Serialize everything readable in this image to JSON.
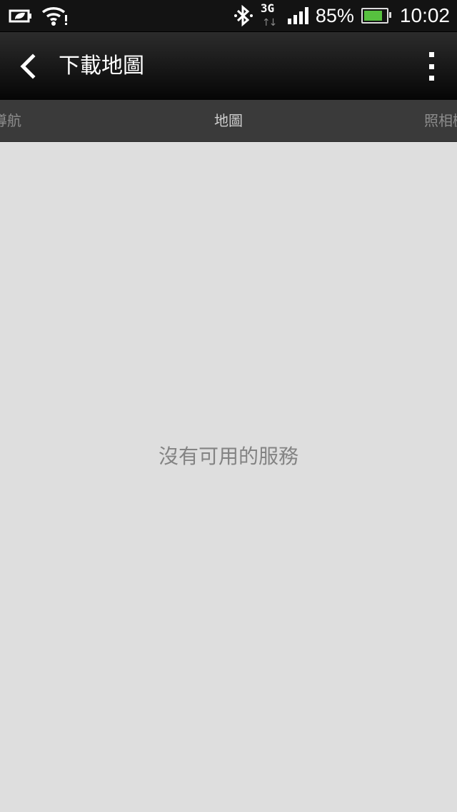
{
  "status_bar": {
    "battery_percent": "85%",
    "time": "10:02",
    "network_type": "3G",
    "battery_level": 0.85,
    "battery_color": "#57c13f",
    "icons": [
      "leaf-battery-icon",
      "wifi-icon",
      "bluetooth-icon",
      "3g-data-icon",
      "signal-icon",
      "battery-icon"
    ]
  },
  "action_bar": {
    "title": "下載地圖",
    "back_icon": "chevron-left-icon",
    "menu_icon": "overflow-menu-icon"
  },
  "tabs": [
    {
      "label": "導航",
      "state": "partial"
    },
    {
      "label": "地圖",
      "state": "selected"
    },
    {
      "label": "照相機",
      "state": "partial"
    }
  ],
  "content": {
    "empty_message": "沒有可用的服務"
  }
}
